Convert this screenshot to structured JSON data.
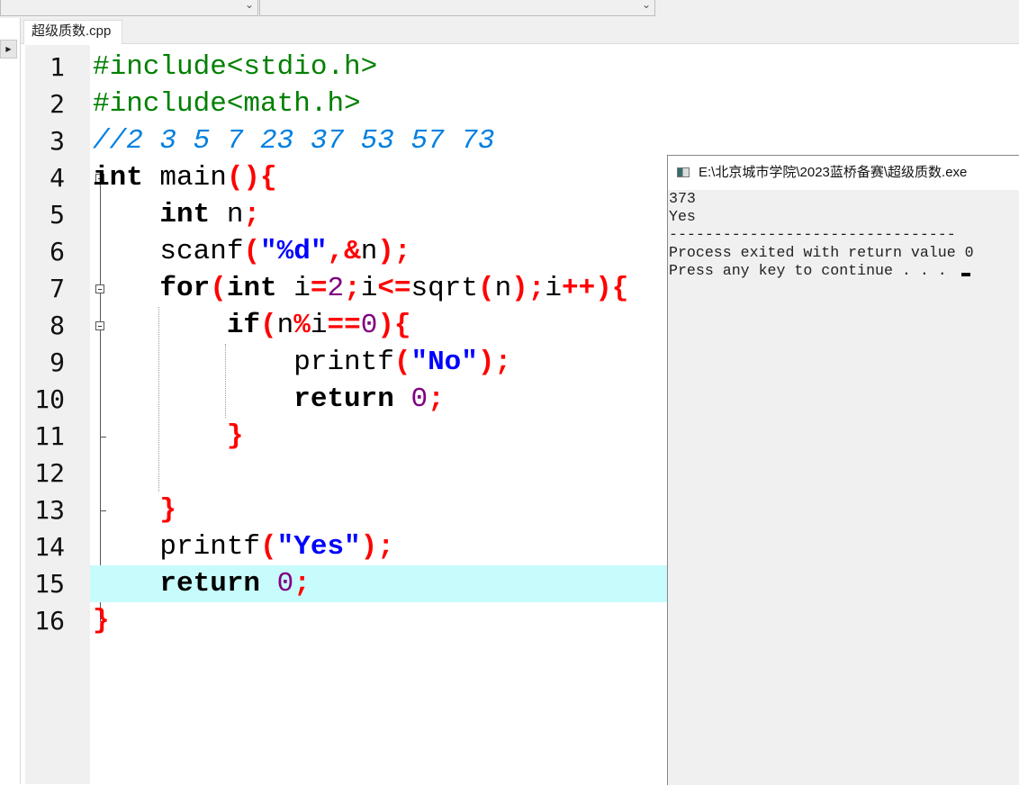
{
  "tab": {
    "label": "超级质数.cpp"
  },
  "editor": {
    "highlighted_line": 15,
    "lines": [
      [
        [
          "#include<stdio.h>",
          "pp"
        ]
      ],
      [
        [
          "#include<math.h>",
          "pp"
        ]
      ],
      [
        [
          "//2 3 5 7 23 37 53 57 73",
          "cm"
        ]
      ],
      [
        [
          "int",
          "kw"
        ],
        [
          " main",
          "id"
        ],
        [
          "(){",
          "sy"
        ]
      ],
      [
        [
          "    ",
          "id"
        ],
        [
          "int",
          "kw"
        ],
        [
          " n",
          "id"
        ],
        [
          ";",
          "sy"
        ]
      ],
      [
        [
          "    scanf",
          "id"
        ],
        [
          "(",
          "sy"
        ],
        [
          "\"%d\"",
          "st"
        ],
        [
          ",&",
          "sy"
        ],
        [
          "n",
          "id"
        ],
        [
          ");",
          "sy"
        ]
      ],
      [
        [
          "    ",
          "id"
        ],
        [
          "for",
          "kw"
        ],
        [
          "(",
          "sy"
        ],
        [
          "int",
          "kw"
        ],
        [
          " i",
          "id"
        ],
        [
          "=",
          "sy"
        ],
        [
          "2",
          "nu"
        ],
        [
          ";",
          "sy"
        ],
        [
          "i",
          "id"
        ],
        [
          "<=",
          "sy"
        ],
        [
          "sqrt",
          "id"
        ],
        [
          "(",
          "sy"
        ],
        [
          "n",
          "id"
        ],
        [
          ");",
          "sy"
        ],
        [
          "i",
          "id"
        ],
        [
          "++){",
          "sy"
        ]
      ],
      [
        [
          "        ",
          "id"
        ],
        [
          "if",
          "kw"
        ],
        [
          "(",
          "sy"
        ],
        [
          "n",
          "id"
        ],
        [
          "%",
          "sy"
        ],
        [
          "i",
          "id"
        ],
        [
          "==",
          "sy"
        ],
        [
          "0",
          "nu"
        ],
        [
          "){",
          "sy"
        ]
      ],
      [
        [
          "            printf",
          "id"
        ],
        [
          "(",
          "sy"
        ],
        [
          "\"No\"",
          "st"
        ],
        [
          ");",
          "sy"
        ]
      ],
      [
        [
          "            ",
          "id"
        ],
        [
          "return",
          "kw"
        ],
        [
          " ",
          "id"
        ],
        [
          "0",
          "nu"
        ],
        [
          ";",
          "sy"
        ]
      ],
      [
        [
          "        ",
          "id"
        ],
        [
          "}",
          "sy"
        ]
      ],
      [
        [
          "",
          "id"
        ]
      ],
      [
        [
          "    ",
          "id"
        ],
        [
          "}",
          "sy"
        ]
      ],
      [
        [
          "    printf",
          "id"
        ],
        [
          "(",
          "sy"
        ],
        [
          "\"Yes\"",
          "st"
        ],
        [
          ");",
          "sy"
        ]
      ],
      [
        [
          "    ",
          "id"
        ],
        [
          "return",
          "kw"
        ],
        [
          " ",
          "id"
        ],
        [
          "0",
          "nu"
        ],
        [
          ";",
          "sy"
        ]
      ],
      [
        [
          "}",
          "sy"
        ]
      ]
    ]
  },
  "console": {
    "title": "E:\\北京城市学院\\2023蓝桥备赛\\超级质数.exe",
    "lines": [
      "373",
      "Yes",
      "--------------------------------",
      "Process exited with return value 0",
      "Press any key to continue . . . "
    ]
  },
  "colors": {
    "highlight": "#c8fbfb",
    "preprocessor": "#008000",
    "comment": "#0080e0",
    "symbol": "#ff0000",
    "number": "#800080",
    "string": "#0000ff"
  }
}
